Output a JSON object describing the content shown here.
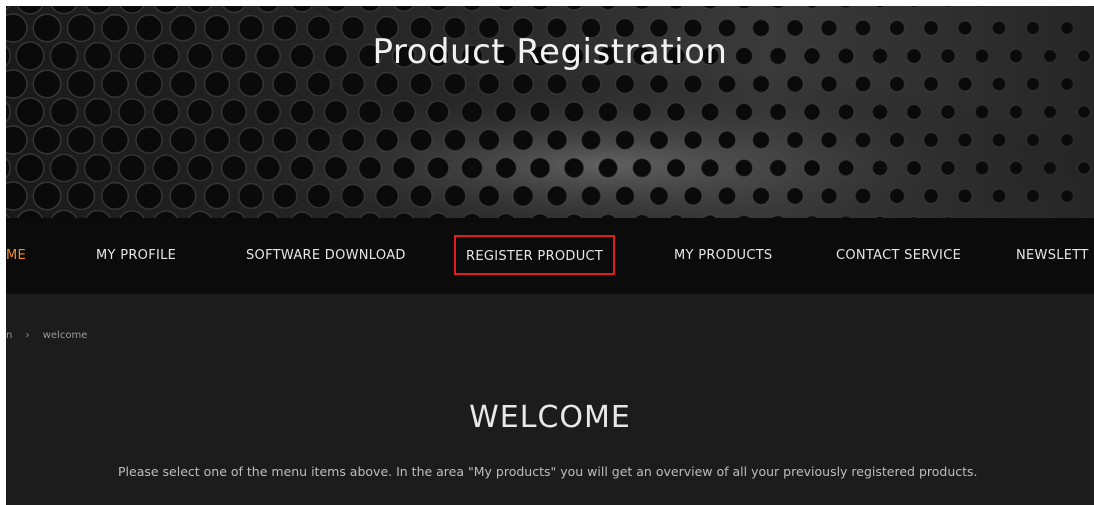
{
  "header": {
    "title": "Product Registration"
  },
  "nav": {
    "items": [
      {
        "label": "ME",
        "state": "active"
      },
      {
        "label": "MY PROFILE"
      },
      {
        "label": "SOFTWARE DOWNLOAD"
      },
      {
        "label": "REGISTER PRODUCT",
        "state": "highlighted"
      },
      {
        "label": "MY PRODUCTS"
      },
      {
        "label": "CONTACT SERVICE"
      },
      {
        "label": "NEWSLETT"
      }
    ]
  },
  "breadcrumb": {
    "first": "n",
    "separator": "›",
    "current": "welcome"
  },
  "main": {
    "title": "WELCOME",
    "text": "Please select one of the menu items above. In the area \"My products\" you will get an overview of all your previously registered products."
  },
  "colors": {
    "accent": "#f08a24",
    "highlight_border": "#e01c1c",
    "nav_background": "#0b0b0b",
    "page_background": "#1c1c1c"
  }
}
